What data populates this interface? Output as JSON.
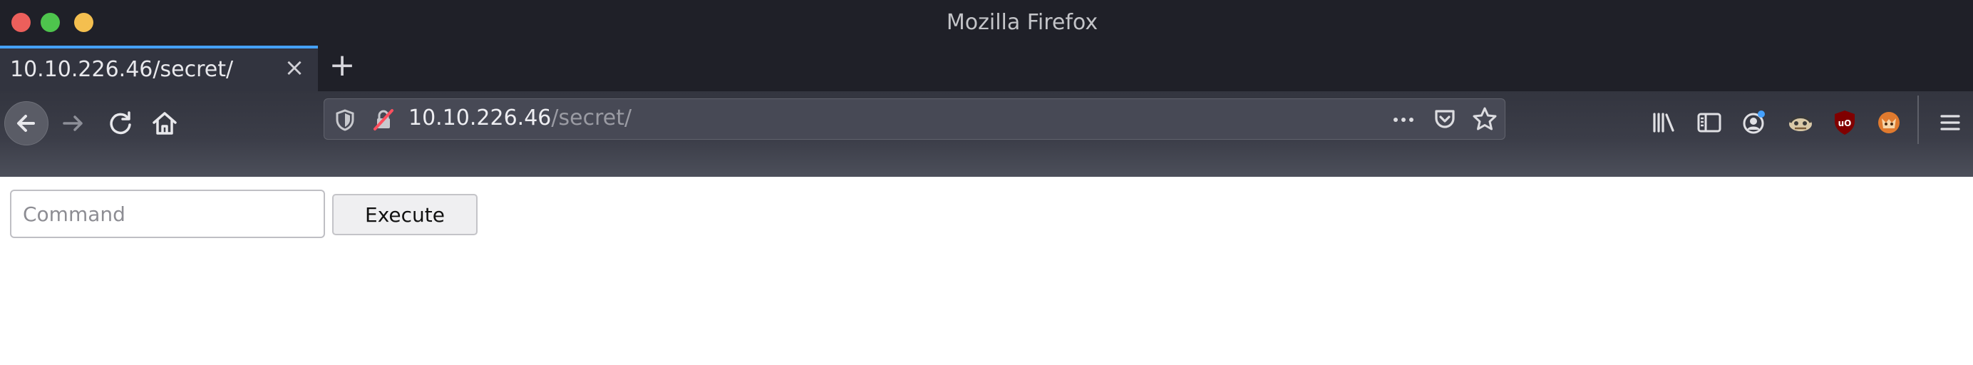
{
  "window": {
    "title": "Mozilla Firefox"
  },
  "tabs": [
    {
      "label": "10.10.226.46/secret/",
      "active": true
    }
  ],
  "nav": {
    "url_host": "10.10.226.46",
    "url_path": "/secret/",
    "icons": {
      "back": "arrow-left-icon",
      "forward": "arrow-right-icon",
      "reload": "reload-icon",
      "home": "home-icon",
      "tracking": "shield-icon",
      "insecure": "insecure-lock-icon",
      "page_actions": "ellipsis-icon",
      "pocket": "pocket-icon",
      "bookmark": "star-icon",
      "library": "library-icon",
      "sidebar": "sidebar-icon",
      "account": "account-icon",
      "ext1": "extension-icon",
      "ublock": "ublock-origin-icon",
      "ext3": "foxyproxy-icon",
      "menu": "hamburger-menu-icon"
    },
    "colors": {
      "accent": "#45a1ff",
      "ublock": "#800000"
    }
  },
  "page": {
    "command_input": {
      "placeholder": "Command",
      "value": ""
    },
    "execute_label": "Execute"
  }
}
